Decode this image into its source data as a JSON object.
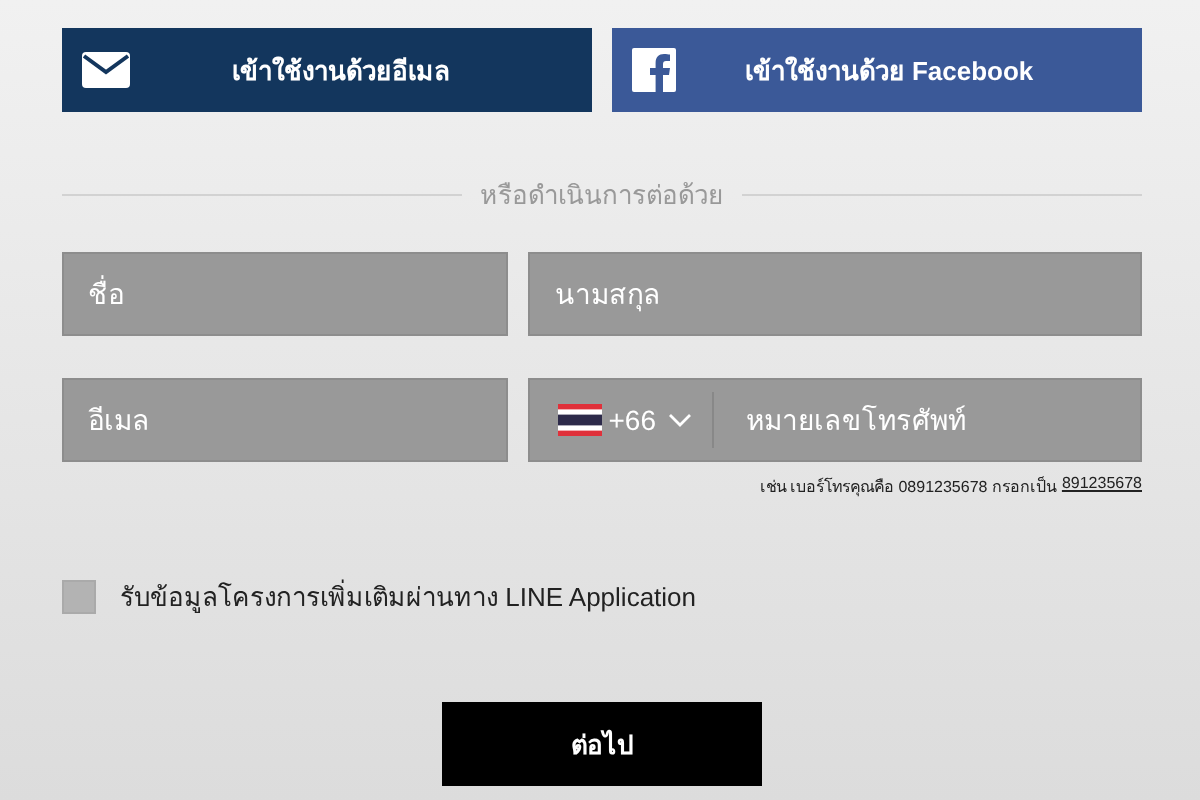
{
  "login_buttons": [
    {
      "kind": "email",
      "label": "เข้าใช้งานด้วยอีเมล"
    },
    {
      "kind": "facebook",
      "label": "เข้าใช้งานด้วย Facebook"
    }
  ],
  "divider_text": "หรือดำเนินการต่อด้วย",
  "fields": [
    {
      "placeholder": "ชื่อ"
    },
    {
      "placeholder": "นามสกุล"
    },
    {
      "placeholder": "อีเมล"
    }
  ],
  "phone": {
    "country_code": "+66",
    "placeholder": "หมายเลขโทรศัพท์"
  },
  "hint": {
    "text": "เช่น เบอร์โทรคุณคือ 0891235678 กรอกเป็น",
    "example": "891235678"
  },
  "consent": {
    "label": "รับข้อมูลโครงการเพิ่มเติมผ่านทาง LINE Application",
    "checked": false
  },
  "submit": "ต่อไป"
}
